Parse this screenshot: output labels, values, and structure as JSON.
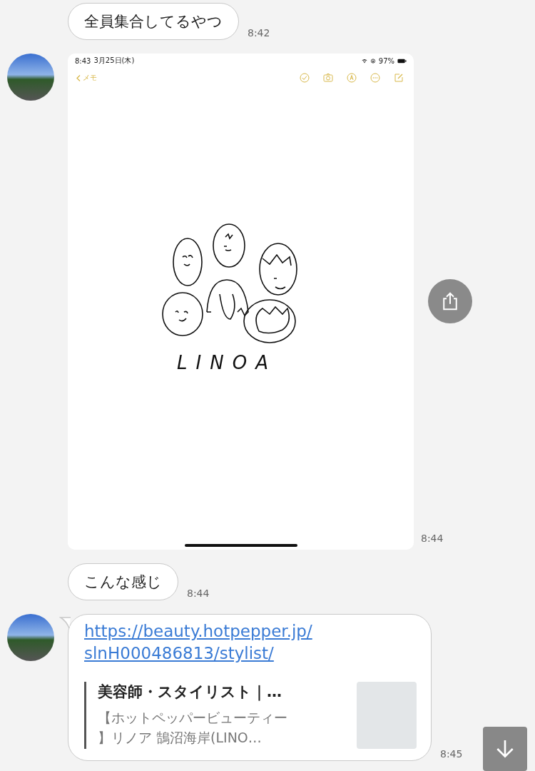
{
  "messages": [
    {
      "kind": "text",
      "avatar": false,
      "text": "全員集合してるやつ",
      "time": "8:42"
    },
    {
      "kind": "image",
      "avatar": true,
      "time": "8:44",
      "screenshot": {
        "status_time": "8:43",
        "status_date": "3月25日(木)",
        "battery": "97%",
        "back_label": "メモ",
        "sketch_text": "LINOA"
      }
    },
    {
      "kind": "text",
      "avatar": false,
      "text": "こんな感じ",
      "time": "8:44"
    },
    {
      "kind": "link",
      "avatar": true,
      "url": "https://beauty.hotpepper.jp/slnH000486813/stylist/",
      "preview_title": "美容師・スタイリスト｜…",
      "preview_description": "【ホットペッパービューティー】リノア 鵠沼海岸(LINO…",
      "time": "8:45"
    }
  ]
}
